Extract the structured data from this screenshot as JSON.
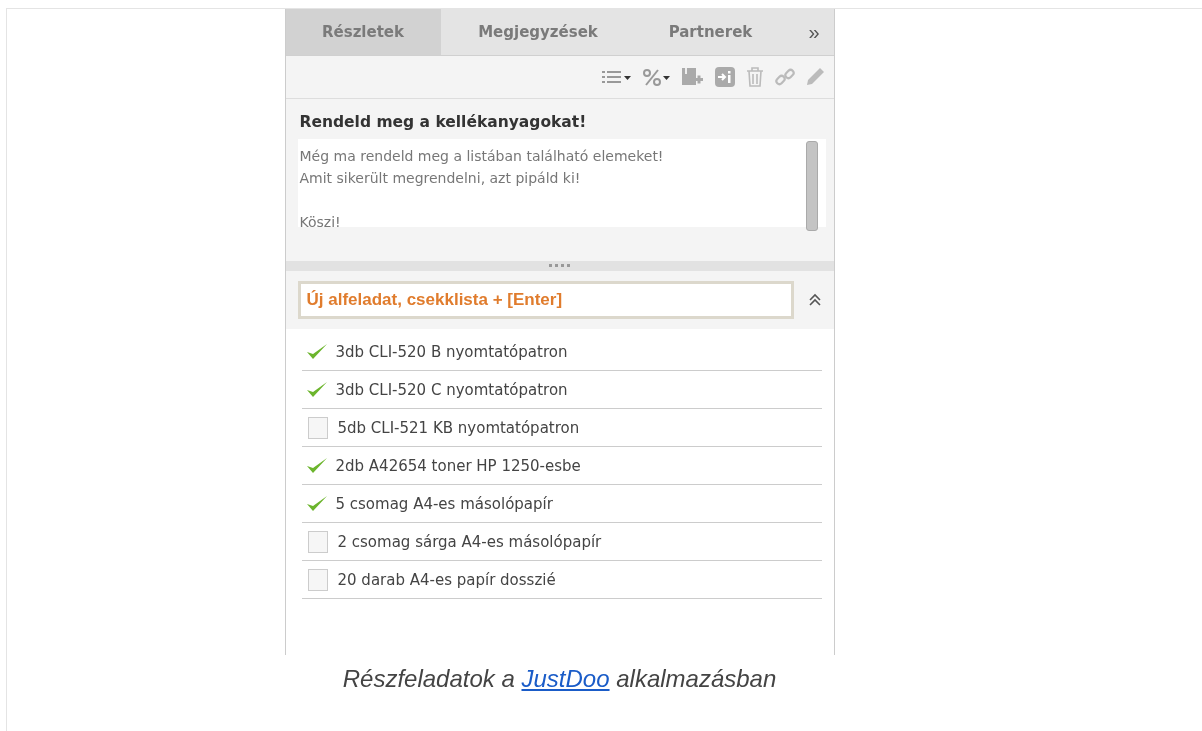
{
  "tabs": [
    {
      "label": "Részletek",
      "selected": true
    },
    {
      "label": "Megjegyzések",
      "selected": false
    },
    {
      "label": "Partnerek",
      "selected": false
    }
  ],
  "tabs_more": "»",
  "task": {
    "title": "Rendeld meg a kellékanyagokat!",
    "description": "Még ma rendeld meg a listában található elemeket!\nAmit sikerült megrendelni, azt pipáld ki!\n\nKöszi!"
  },
  "subtask_input": {
    "placeholder": "Új alfeladat, csekklista + [Enter]"
  },
  "checklist": [
    {
      "label": "3db CLI-520 B nyomtatópatron",
      "checked": true
    },
    {
      "label": "3db CLI-520 C nyomtatópatron",
      "checked": true
    },
    {
      "label": "5db CLI-521 KB nyomtatópatron",
      "checked": false
    },
    {
      "label": "2db A42654 toner HP 1250-esbe",
      "checked": true
    },
    {
      "label": "5 csomag A4-es másolópapír",
      "checked": true
    },
    {
      "label": "2 csomag sárga A4-es másolópapír",
      "checked": false
    },
    {
      "label": "20 darab A4-es papír dosszié",
      "checked": false
    }
  ],
  "caption": {
    "before": "Részfeladatok a",
    "link": "JustDoo",
    "after": "alkalmazásban"
  }
}
